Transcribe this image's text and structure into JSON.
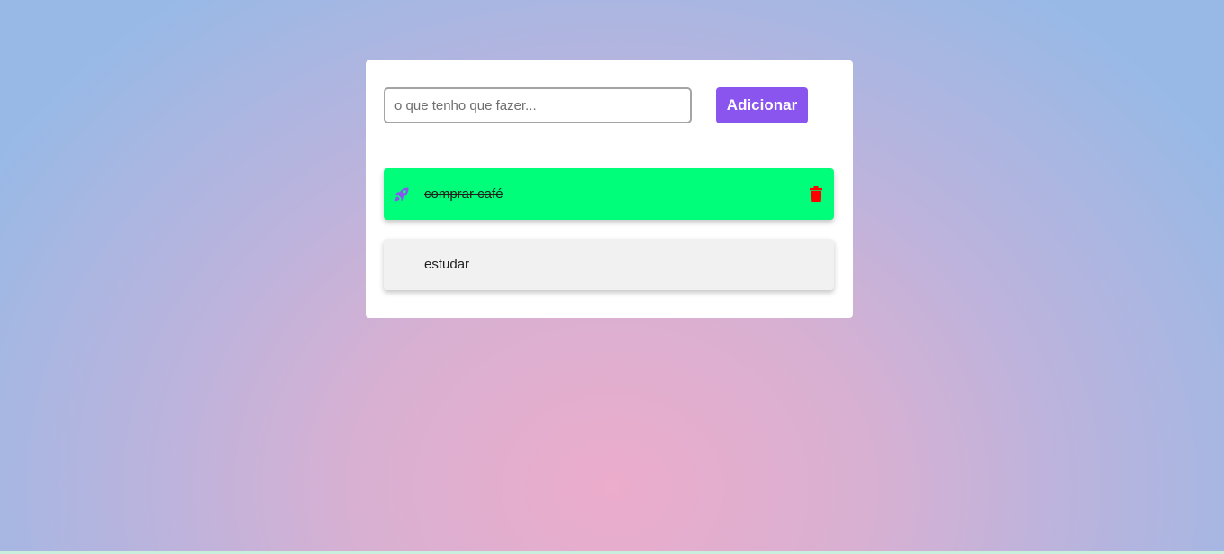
{
  "colors": {
    "accent": "#8a55ef",
    "done_item_bg": "#00fe7b",
    "item_bg": "#f1f1f1",
    "delete_red": "#ff0000"
  },
  "form": {
    "input_value": "",
    "input_placeholder": "o que tenho que fazer...",
    "add_button_label": "Adicionar"
  },
  "tasks": [
    {
      "label": "comprar café",
      "done": true,
      "icon": "rocket-icon",
      "delete_icon": "trash-icon"
    },
    {
      "label": "estudar",
      "done": false
    }
  ]
}
